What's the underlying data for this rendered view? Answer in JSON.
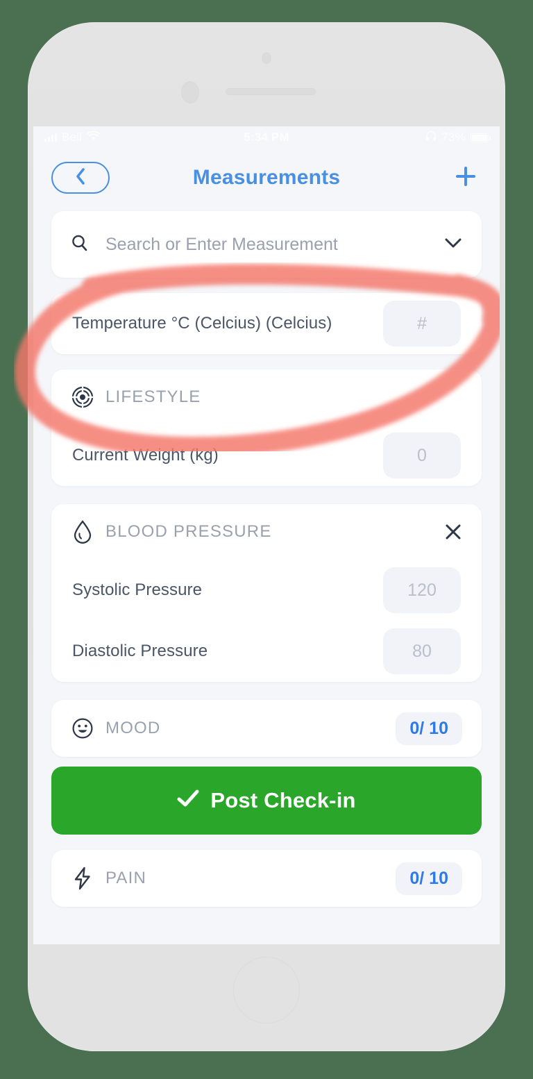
{
  "status_bar": {
    "carrier": "Bell",
    "time": "5:34 PM",
    "battery_percent": "73%",
    "signal_icon": "signal-bars-icon",
    "wifi_icon": "wifi-icon",
    "headphones_icon": "headphones-icon",
    "battery_icon": "battery-icon"
  },
  "nav": {
    "title": "Measurements",
    "back_icon": "chevron-left-icon",
    "add_icon": "plus-icon"
  },
  "search": {
    "placeholder": "Search or Enter Measurement",
    "value": "",
    "search_icon": "search-icon",
    "chevron_icon": "chevron-down-icon"
  },
  "temperature": {
    "label": "Temperature °C (Celcius) (Celcius)",
    "input_placeholder": "#",
    "input_value": ""
  },
  "lifestyle": {
    "title": "LIFESTYLE",
    "icon": "lifestyle-spiral-icon",
    "rows": [
      {
        "label": "Current Weight (kg)",
        "placeholder": "0",
        "value": ""
      }
    ]
  },
  "blood_pressure": {
    "title": "BLOOD PRESSURE",
    "icon": "blood-drop-icon",
    "close_icon": "close-icon",
    "rows": [
      {
        "label": "Systolic Pressure",
        "placeholder": "120",
        "value": ""
      },
      {
        "label": "Diastolic Pressure",
        "placeholder": "80",
        "value": ""
      }
    ]
  },
  "mood": {
    "title": "MOOD",
    "icon": "smiley-face-icon",
    "score": "0/ 10"
  },
  "pain": {
    "title": "PAIN",
    "icon": "lightning-bolt-icon",
    "score": "0/ 10"
  },
  "post_checkin": {
    "label": "Post Check-in",
    "check_icon": "checkmark-icon"
  },
  "annotation": {
    "type": "hand-drawn-ellipse",
    "color": "#f4776b",
    "target": "Temperature °C (Celcius) (Celcius)"
  },
  "colors": {
    "accent_blue": "#4a90e2",
    "badge_blue": "#2f7ae5",
    "green_button": "#2aa62a",
    "annotation_red": "#f4776b",
    "page_background": "#4a7051",
    "screen_background": "#f4f6fa"
  }
}
